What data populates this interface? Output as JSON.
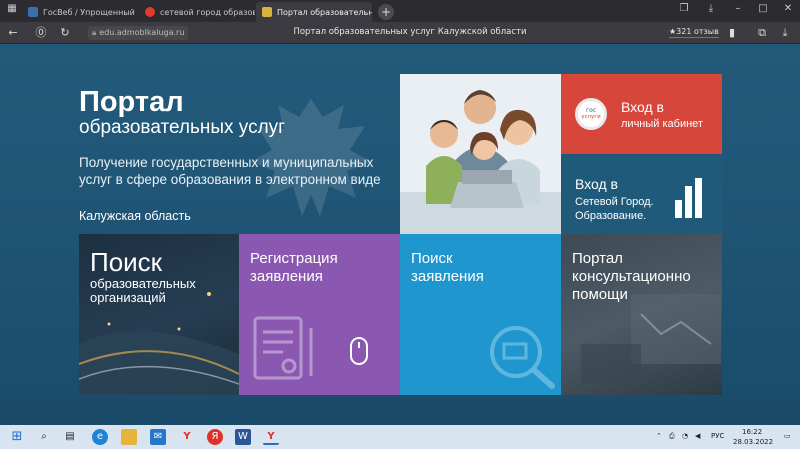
{
  "browser": {
    "tabs": [
      {
        "label": "ГосВеб / Упрощенный вв",
        "active": false
      },
      {
        "label": "сетевой город образован",
        "active": false
      },
      {
        "label": "Портал образовательн",
        "active": true
      }
    ],
    "new_tab": "+",
    "url": "edu.admoblkaluga.ru",
    "page_title": "Портал образовательных услуг Калужской области",
    "reviews": "★321 отзыв"
  },
  "hero": {
    "title_line1": "Портал",
    "title_line2": "образовательных услуг",
    "subtitle": "Получение государственных и муниципальных услуг в сфере образования в электронном виде",
    "region": "Калужская область"
  },
  "tiles": {
    "personal_cabinet": {
      "title": "Вход в",
      "subtitle": "личный кабинет",
      "badge_top": "гос",
      "badge_bottom": "услуги"
    },
    "network_city": {
      "title": "Вход в",
      "subtitle_line1": "Сетевой Город.",
      "subtitle_line2": "Образование."
    },
    "search_orgs": {
      "title": "Поиск",
      "subtitle_line1": "образовательных",
      "subtitle_line2": "организаций"
    },
    "registration": {
      "title_line1": "Регистрация",
      "title_line2": "заявления"
    },
    "find_application": {
      "title_line1": "Поиск",
      "title_line2": "заявления"
    },
    "consultation": {
      "title_line1": "Портал",
      "title_line2": "консультационно",
      "title_line3": "помощи"
    }
  },
  "taskbar": {
    "language": "РУС",
    "time": "16:22",
    "date": "28.03.2022"
  },
  "colors": {
    "tile_red": "#d6463a",
    "tile_purple": "#8a58b0",
    "tile_blue": "#1f96cd",
    "page_bg": "#1e5374"
  }
}
